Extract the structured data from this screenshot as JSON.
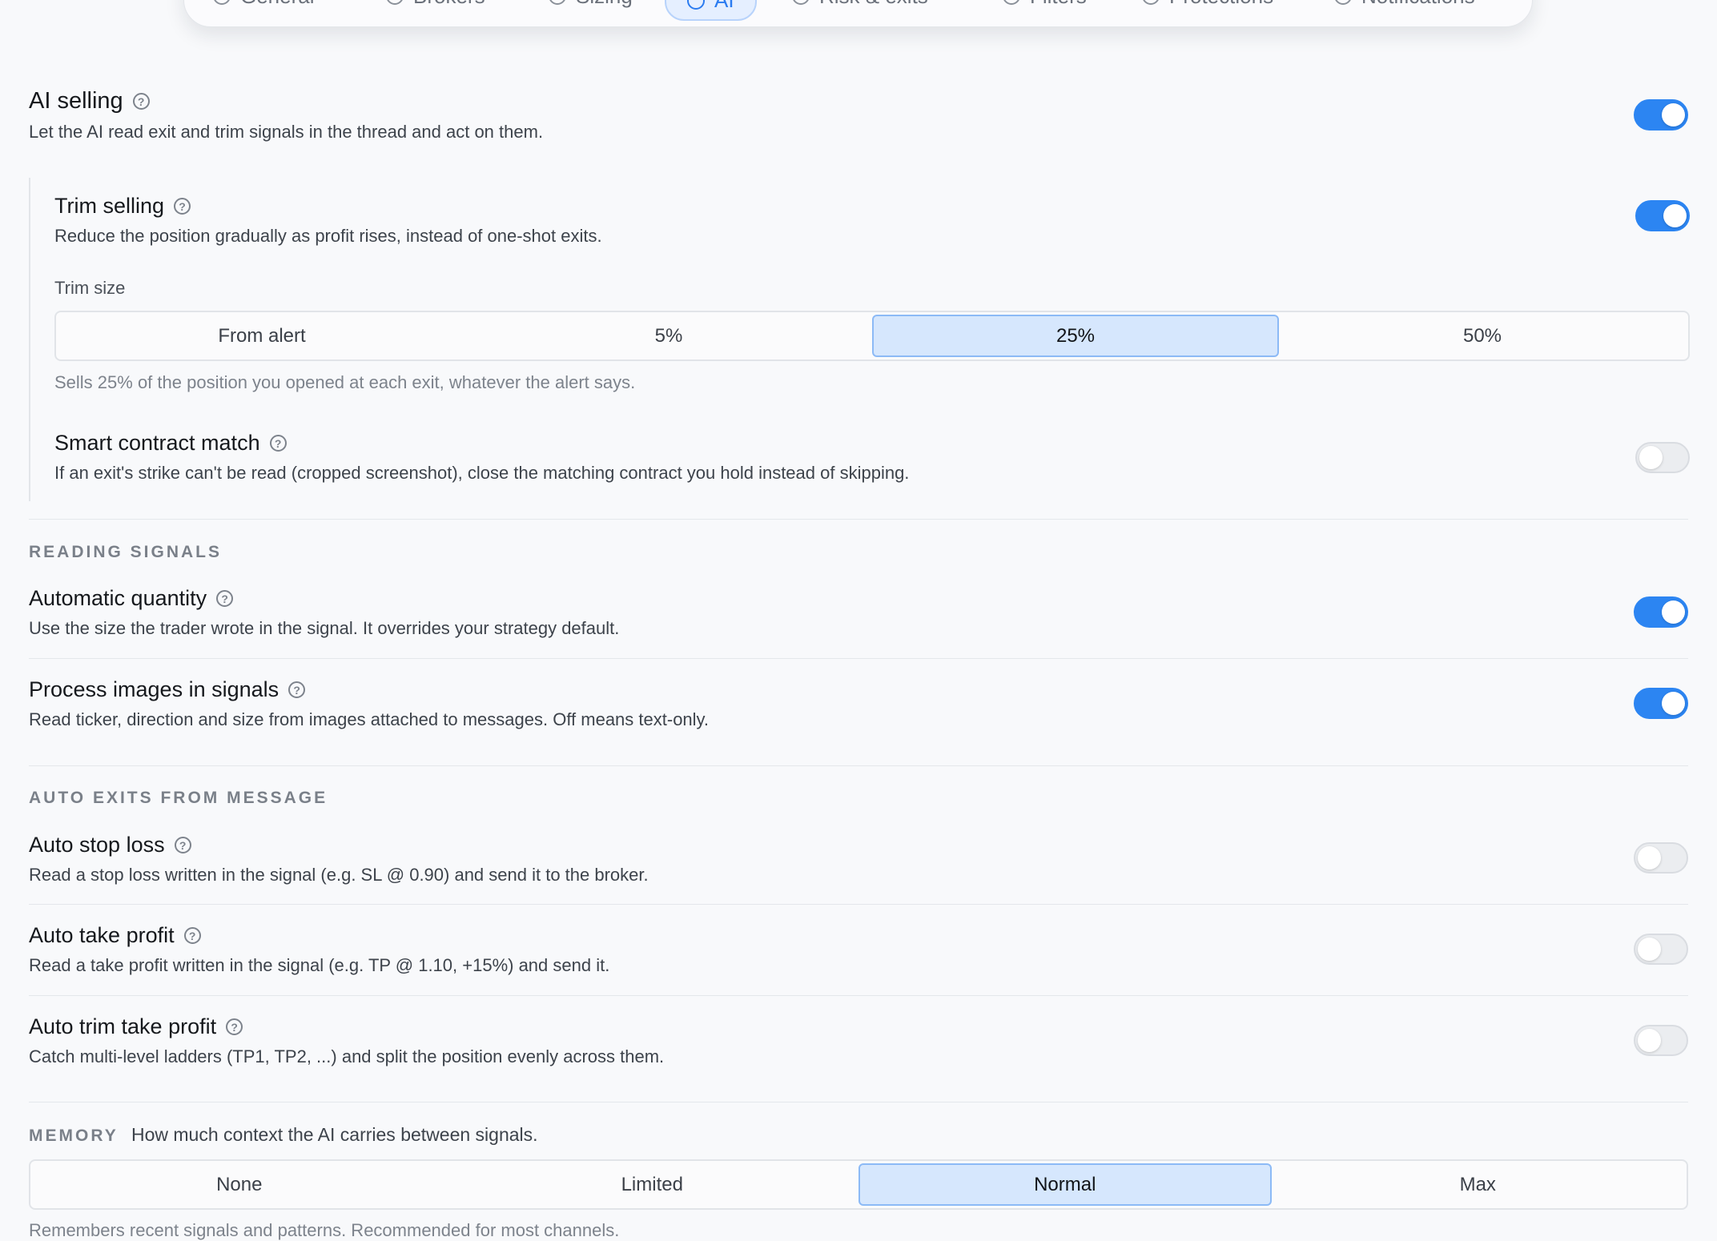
{
  "tabs": [
    {
      "label": "General",
      "icon": "sliders-icon",
      "dot": "#f59a9a"
    },
    {
      "label": "Brokers",
      "icon": "plug-icon"
    },
    {
      "label": "Sizing",
      "icon": "calculator-icon"
    },
    {
      "label": "AI",
      "icon": "sparkle-icon",
      "active": true
    },
    {
      "label": "Risk & exits",
      "icon": "target-icon",
      "dot": "#f5c29a"
    },
    {
      "label": "Filters",
      "icon": "filter-icon"
    },
    {
      "label": "Protections",
      "icon": "shield-icon"
    },
    {
      "label": "Notifications",
      "icon": "bell-icon"
    }
  ],
  "ai_selling": {
    "title": "AI selling",
    "desc": "Let the AI read exit and trim signals in the thread and act on them.",
    "enabled": true
  },
  "trim_selling": {
    "title": "Trim selling",
    "desc": "Reduce the position gradually as profit rises, instead of one-shot exits.",
    "enabled": true,
    "size_label": "Trim size",
    "options": [
      "From alert",
      "5%",
      "25%",
      "50%"
    ],
    "selected": "25%",
    "hint": "Sells 25% of the position you opened at each exit, whatever the alert says."
  },
  "smart_contract": {
    "title": "Smart contract match",
    "desc": "If an exit's strike can't be read (cropped screenshot), close the matching contract you hold instead of skipping.",
    "enabled": false
  },
  "reading_signals": {
    "heading": "READING SIGNALS",
    "auto_quantity": {
      "title": "Automatic quantity",
      "desc": "Use the size the trader wrote in the signal. It overrides your strategy default.",
      "enabled": true
    },
    "process_images": {
      "title": "Process images in signals",
      "desc": "Read ticker, direction and size from images attached to messages. Off means text-only.",
      "enabled": true
    }
  },
  "auto_exits": {
    "heading": "AUTO EXITS FROM MESSAGE",
    "stop_loss": {
      "title": "Auto stop loss",
      "desc": "Read a stop loss written in the signal (e.g. SL @ 0.90) and send it to the broker.",
      "enabled": false
    },
    "take_profit": {
      "title": "Auto take profit",
      "desc": "Read a take profit written in the signal (e.g. TP @ 1.10, +15%) and send it.",
      "enabled": false
    },
    "trim_take_profit": {
      "title": "Auto trim take profit",
      "desc": "Catch multi-level ladders (TP1, TP2, ...) and split the position evenly across them.",
      "enabled": false
    }
  },
  "memory": {
    "heading": "MEMORY",
    "desc": "How much context the AI carries between signals.",
    "options": [
      "None",
      "Limited",
      "Normal",
      "Max"
    ],
    "selected": "Normal",
    "hint": "Remembers recent signals and patterns. Recommended for most channels."
  },
  "colors": {
    "accent": "#2c85f2",
    "selected_bg": "#d6e7fd"
  }
}
